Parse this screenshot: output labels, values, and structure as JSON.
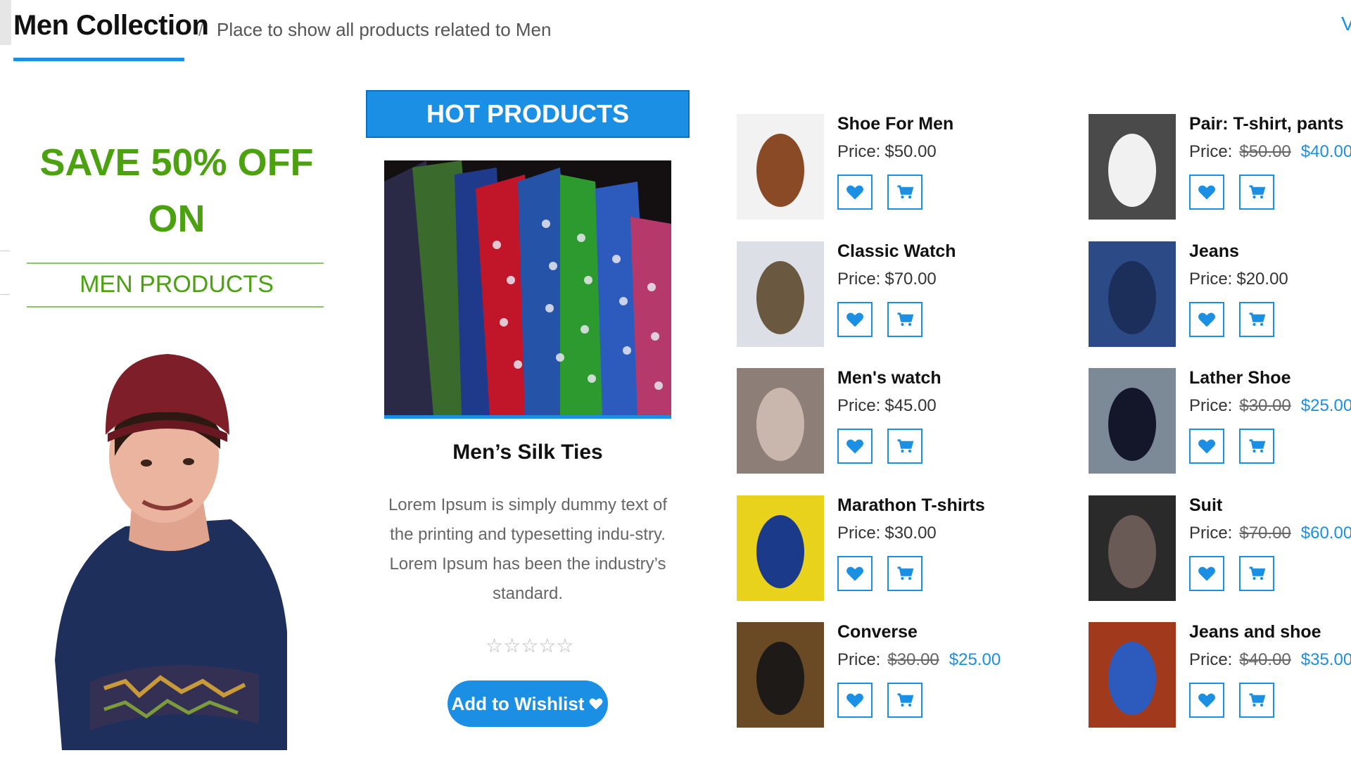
{
  "header": {
    "title": "Men Collection",
    "separator": "/",
    "subtitle": "Place to show all products related to Men",
    "right_link": "V"
  },
  "promo": {
    "line1": "SAVE 50% OFF",
    "line2": "ON",
    "sub": "MEN PRODUCTS"
  },
  "hot": {
    "banner": "HOT PRODUCTS",
    "title": "Men’s Silk Ties",
    "description": "Lorem Ipsum is simply dummy text of the printing and typesetting indu-stry. Lorem Ipsum has been the industry’s standard.",
    "rating_stars": "☆☆☆☆☆",
    "rating_value": 0,
    "wishlist_label": "Add to Wishlist"
  },
  "price_label": "Price:",
  "products_left": [
    {
      "name": "Shoe For Men",
      "price": "$50.00"
    },
    {
      "name": "Classic Watch",
      "price": "$70.00"
    },
    {
      "name": "Men's watch",
      "price": "$45.00"
    },
    {
      "name": "Marathon T-shirts",
      "price": "$30.00"
    },
    {
      "name": "Converse",
      "old_price": "$30.00",
      "new_price": "$25.00"
    }
  ],
  "products_right": [
    {
      "name": "Pair: T-shirt, pants",
      "old_price": "$50.00",
      "new_price": "$40.00"
    },
    {
      "name": "Jeans",
      "price": "$20.00"
    },
    {
      "name": "Lather Shoe",
      "old_price": "$30.00",
      "new_price": "$25.00"
    },
    {
      "name": "Suit",
      "old_price": "$70.00",
      "new_price": "$60.00"
    },
    {
      "name": "Jeans and shoe",
      "old_price": "$40.00",
      "new_price": "$35.00"
    }
  ],
  "icons": {
    "wishlist": "heart-icon",
    "cart": "cart-icon"
  },
  "colors": {
    "accent": "#1a8fe3",
    "promo_green": "#4ba10f"
  }
}
